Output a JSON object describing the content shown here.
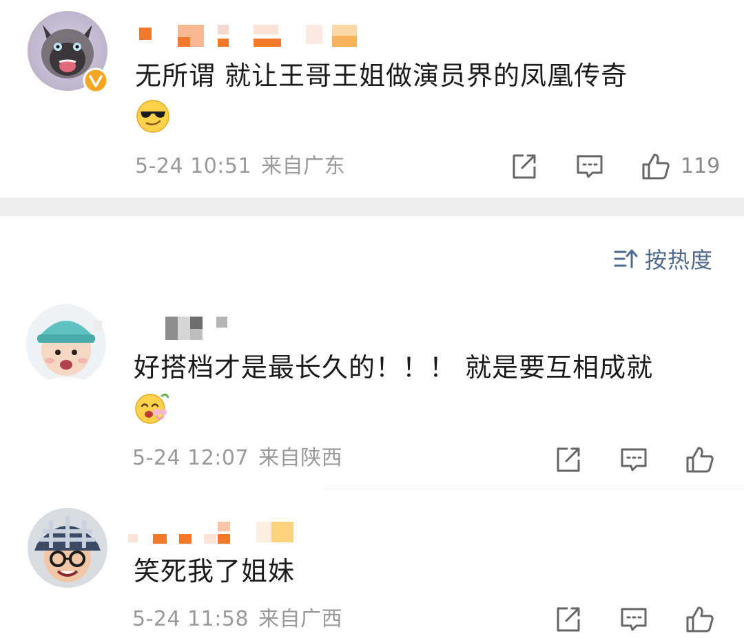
{
  "comments": [
    {
      "text": "无所谓 就让王哥王姐做演员界的凤凰传奇",
      "emoji": "sunglasses-emoji",
      "date": "5-24 10:51",
      "location": "来自广东",
      "likes": "119",
      "verified": true
    },
    {
      "text": "好搭档才是最长久的！！！ 就是要互相成就",
      "emoji": "flower-emoji",
      "date": "5-24 12:07",
      "location": "来自陕西",
      "likes": ""
    },
    {
      "text": "笑死我了姐妹",
      "emoji": "",
      "date": "5-24 11:58",
      "location": "来自广西",
      "likes": ""
    }
  ],
  "sort": {
    "label": "按热度",
    "icon": "sort-icon"
  },
  "colors": {
    "text": "#1b1b1b",
    "meta": "#9a9a9a",
    "sort": "#4e6a8c",
    "divider": "#eeeeee",
    "verified_badge": "#f5a623"
  }
}
